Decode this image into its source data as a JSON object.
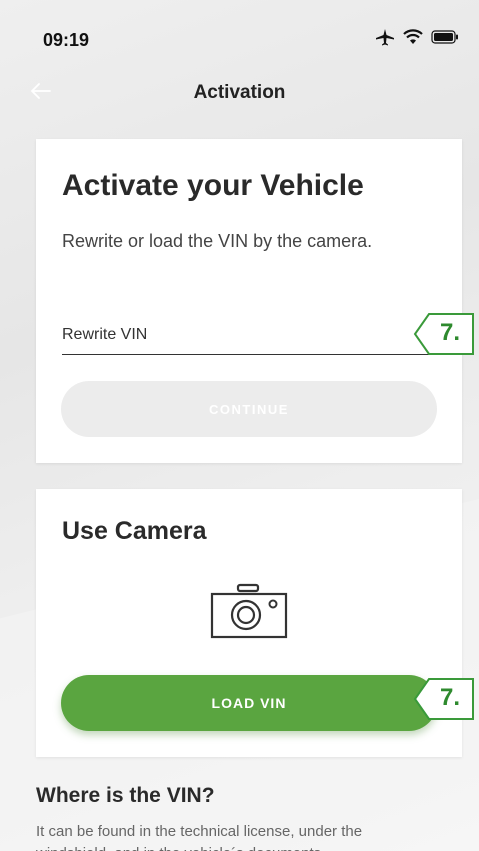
{
  "status_bar": {
    "time": "09:19"
  },
  "nav": {
    "title": "Activation"
  },
  "activate_card": {
    "title": "Activate your Vehicle",
    "subtitle": "Rewrite or load the VIN by the camera.",
    "vin_placeholder": "Rewrite VIN",
    "continue_label": "CONTINUE"
  },
  "camera_card": {
    "title": "Use Camera",
    "load_label": "LOAD VIN"
  },
  "badges": {
    "step_1": "7.",
    "step_2": "7."
  },
  "where": {
    "title": "Where is the VIN?",
    "text": "It can be found in the technical license, under the windshield, and in the vehicle´s documents."
  },
  "colors": {
    "accent_green": "#5aa540",
    "badge_green": "#2e8a2e"
  },
  "icons": [
    "back-arrow-icon",
    "airplane-icon",
    "wifi-icon",
    "battery-icon",
    "camera-icon"
  ]
}
